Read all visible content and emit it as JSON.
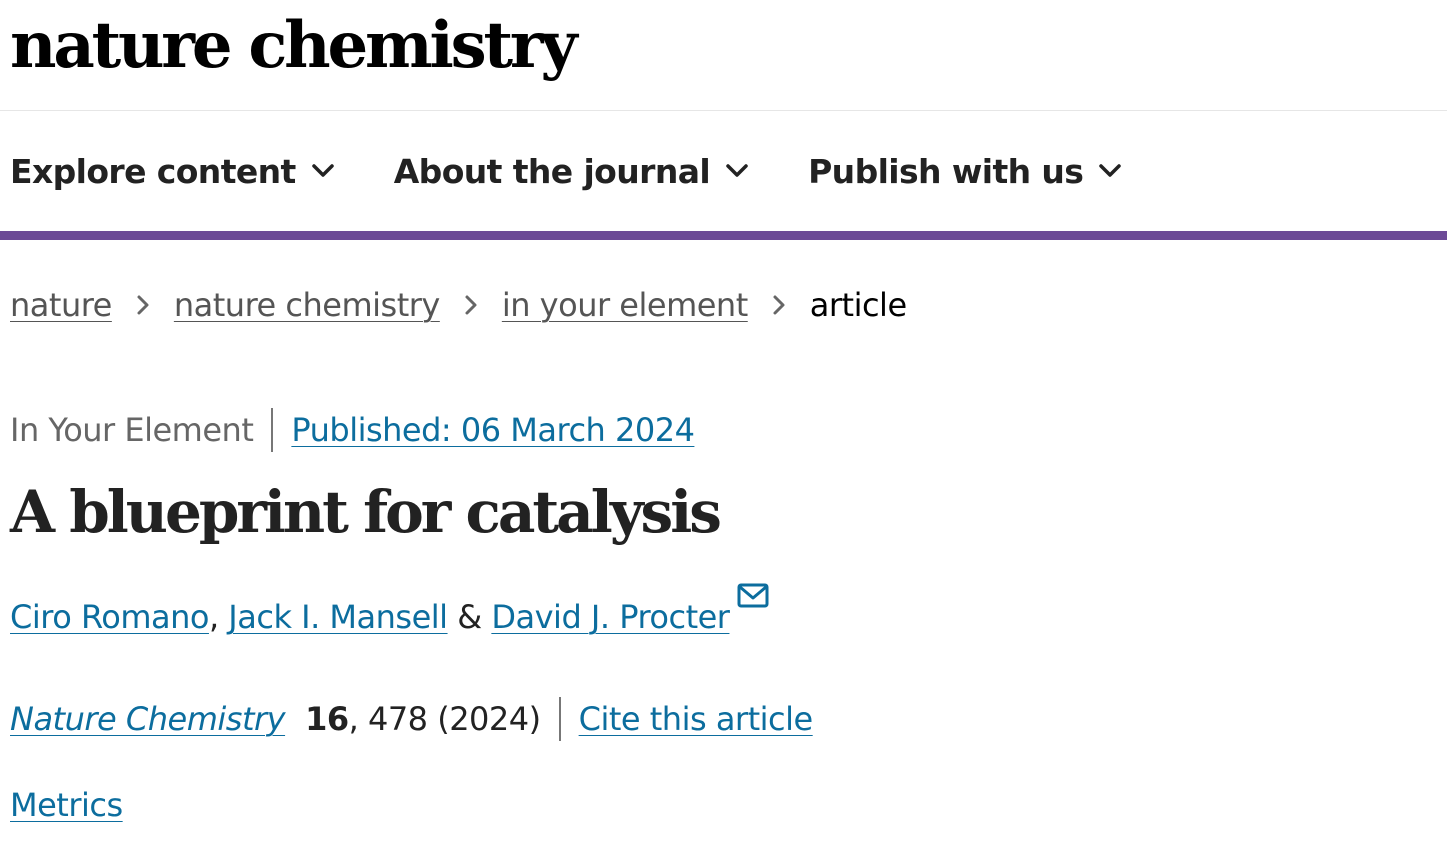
{
  "header": {
    "logo_text": "nature chemistry"
  },
  "nav": {
    "items": [
      {
        "label": "Explore content",
        "icon": "chevron-down-icon"
      },
      {
        "label": "About the journal",
        "icon": "chevron-down-icon"
      },
      {
        "label": "Publish with us",
        "icon": "chevron-down-icon"
      }
    ],
    "accent_color": "#6c4a96"
  },
  "breadcrumb": {
    "items": [
      "nature",
      "nature chemistry",
      "in your element"
    ],
    "current": "article",
    "separator_icon": "chevron-right-icon"
  },
  "article": {
    "type": "In Your Element",
    "published": "Published: 06 March 2024",
    "title": "A blueprint for catalysis",
    "authors": [
      "Ciro Romano",
      "Jack I. Mansell",
      "David J. Procter"
    ],
    "author_separator_comma": ", ",
    "author_separator_amp": " & ",
    "corresponding_icon": "mail-icon",
    "citation": {
      "journal": "Nature Chemistry",
      "volume": "16",
      "pages_year": ", 478 (2024)",
      "cite_link": "Cite this article"
    },
    "metrics_link": "Metrics",
    "link_color": "#0c6d9e"
  }
}
